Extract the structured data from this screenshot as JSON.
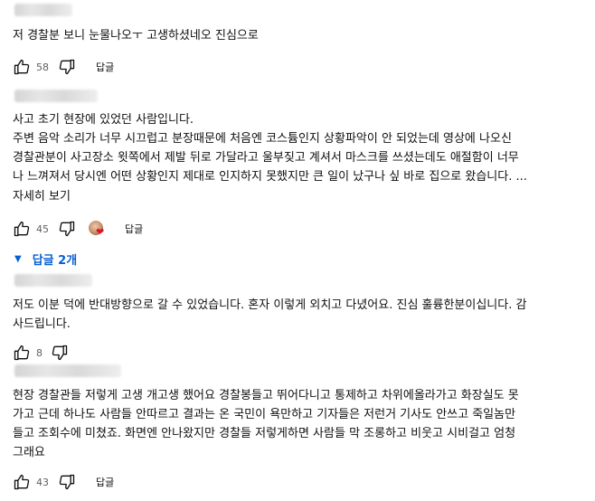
{
  "comments": [
    {
      "text_lines": [
        "저 경찰분 보니 눈물나오ㅜ 고생하셨네오 진심으로"
      ],
      "likes": "58",
      "reply_label": "답글"
    },
    {
      "text_lines": [
        "사고 초기 현장에 있었던 사람입니다.",
        "주변 음악 소리가 너무 시끄럽고 분장때문에 처음엔 코스튬인지 상황파악이 안 되었는데 영상에 나오신",
        "경찰관분이 사고장소 윗쪽에서 제발 뒤로 가달라고 울부짖고 계셔서 마스크를 쓰셨는데도 애절함이 너무",
        "나 느껴져서 당시엔 어떤 상황인지 제대로 인지하지 못했지만 큰 일이 났구나 싶 바로 집으로 왔습니다. ..."
      ],
      "more_label": "자세히 보기",
      "likes": "45",
      "reply_label": "답글",
      "replies_label": "답글 2개"
    },
    {
      "text_lines": [
        "저도 이분 덕에 반대방향으로 갈 수 있었습니다. 혼자 이렇게 외치고 다녔어요. 진심 훌륭한분이십니다. 감",
        "사드립니다."
      ],
      "likes": "8",
      "reply_label": "답글"
    },
    {
      "text_lines": [
        "현장 경찰관들 저렇게 고생 개고생 했어요 경찰봉들고 뛰어다니고 통제하고 차위에올라가고 화장실도 못",
        "가고 근데 하나도 사람들 안따르고 결과는 온 국민이 욕만하고 기자들은 저런거 기사도 안쓰고 죽일놈만",
        "들고 조회수에 미쳤죠. 화면엔 안나왔지만 경찰들 저렇게하면 사람들 막 조롱하고 비웃고 시비걸고 엄청",
        "그래요"
      ],
      "likes": "43",
      "reply_label": "답글"
    }
  ]
}
